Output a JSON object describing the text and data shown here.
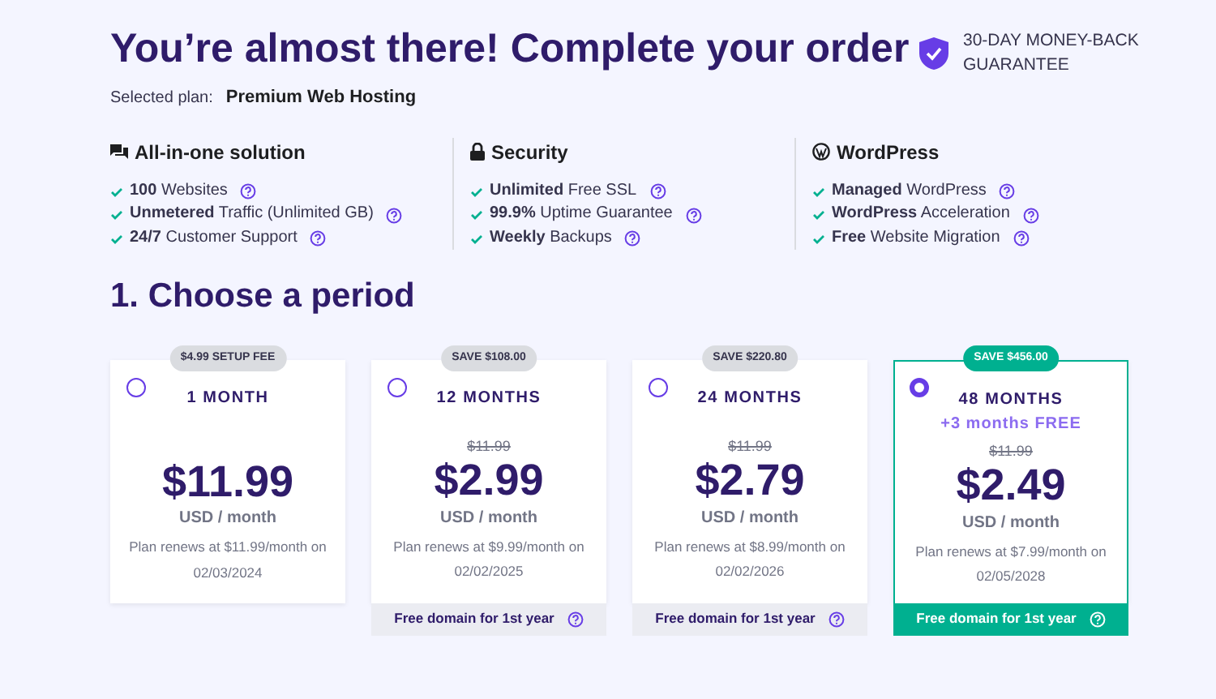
{
  "title": "You’re almost there! Complete your order",
  "guarantee": "30-DAY MONEY-BACK GUARANTEE",
  "selected_plan": {
    "label": "Selected plan:",
    "value": "Premium Web Hosting"
  },
  "features": [
    {
      "kind": "chat",
      "title": "All-in-one solution",
      "items": [
        "**100** Websites",
        "**Unmetered** Traffic (Unlimited GB)",
        "**24/7** Customer Support"
      ]
    },
    {
      "kind": "lock",
      "title": "Security",
      "items": [
        "**Unlimited** Free SSL",
        "**99.9%** Uptime Guarantee",
        "**Weekly** Backups"
      ]
    },
    {
      "kind": "wordpress",
      "title": "WordPress",
      "items": [
        "**Managed** WordPress",
        "**WordPress** Acceleration",
        "**Free** Website Migration"
      ]
    }
  ],
  "period_heading": "1. Choose a period",
  "plans": [
    {
      "badge": "$4.99 SETUP FEE",
      "selected": false,
      "title": "1 MONTH",
      "price": "$11.99",
      "unit": "USD / month",
      "renew": "Plan renews at $11.99/month on 02/03/2024"
    },
    {
      "badge": "SAVE $108.00",
      "selected": false,
      "title": "12 MONTHS",
      "old_price": "$11.99",
      "price": "$2.99",
      "unit": "USD / month",
      "renew": "Plan renews at $9.99/month on 02/02/2025",
      "footer": "Free domain for 1st year"
    },
    {
      "badge": "SAVE $220.80",
      "selected": false,
      "title": "24 MONTHS",
      "old_price": "$11.99",
      "price": "$2.79",
      "unit": "USD / month",
      "renew": "Plan renews at $8.99/month on 02/02/2026",
      "footer": "Free domain for 1st year"
    },
    {
      "badge": "SAVE $456.00",
      "selected": true,
      "title": "48 MONTHS",
      "bonus": "+3 months FREE",
      "old_price": "$11.99",
      "price": "$2.49",
      "unit": "USD / month",
      "renew": "Plan renews at $7.99/month on 02/05/2028",
      "footer": "Free domain for 1st year"
    }
  ]
}
